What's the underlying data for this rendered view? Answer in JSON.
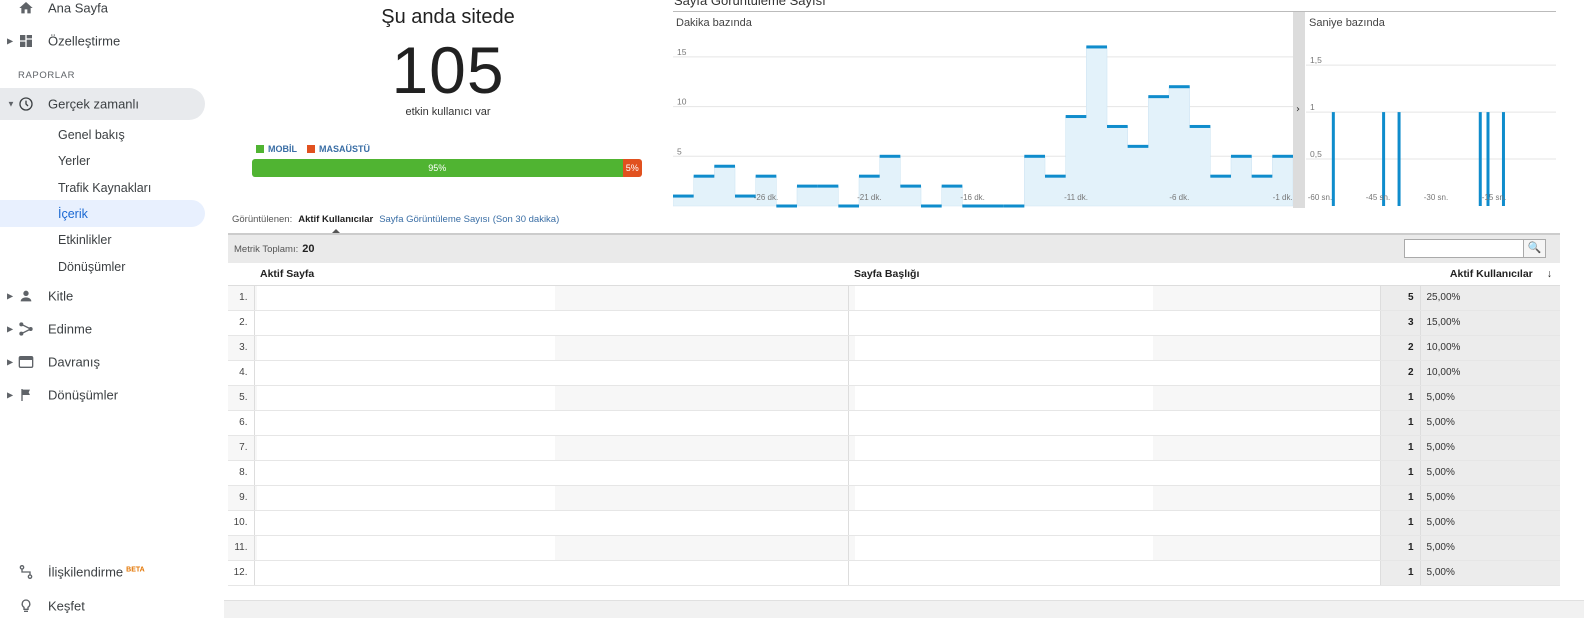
{
  "sidebar": {
    "home": "Ana Sayfa",
    "customize": "Özelleştirme",
    "section": "RAPORLAR",
    "realtime": "Gerçek zamanlı",
    "sub": [
      "Genel bakış",
      "Yerler",
      "Trafik Kaynakları",
      "İçerik",
      "Etkinlikler",
      "Dönüşümler"
    ],
    "audience": "Kitle",
    "acquisition": "Edinme",
    "behavior": "Davranış",
    "conversions": "Dönüşümler",
    "attribution": "İlişkilendirme",
    "attribution_badge": "BETA",
    "discover": "Keşfet"
  },
  "summary": {
    "title": "Şu anda sitede",
    "count": "105",
    "caption": "etkin kullanıcı var",
    "mobile_label": "MOBİL",
    "desktop_label": "MASAÜSTÜ",
    "mobile_pct": "95%",
    "desktop_pct": "5%",
    "mobile_fraction": 0.95,
    "colors": {
      "mobile": "#50b432",
      "desktop": "#e1511f"
    }
  },
  "chart_data": [
    {
      "type": "bar",
      "title": "Sayfa Görüntüleme Sayısı",
      "subtitle": "Dakika bazında",
      "x_tick_labels": [
        "-26 dk.",
        "-21 dk.",
        "-16 dk.",
        "-11 dk.",
        "-6 dk.",
        "-1 dk."
      ],
      "y_tick_labels": [
        "5",
        "10",
        "15"
      ],
      "ylim": [
        0,
        17
      ],
      "values": [
        1,
        3,
        4,
        1,
        3,
        0,
        2,
        2,
        0,
        3,
        5,
        2,
        0,
        2,
        0,
        0,
        0,
        5,
        3,
        9,
        16,
        8,
        6,
        11,
        12,
        8,
        3,
        5,
        3,
        5
      ],
      "color": "#0f8ccc"
    },
    {
      "type": "bar",
      "subtitle": "Saniye bazında",
      "x_tick_labels": [
        "-60 sn.",
        "-45 sn.",
        "-30 sn.",
        "-15 sn."
      ],
      "y_tick_labels": [
        "0,5",
        "1",
        "1,5"
      ],
      "ylim": [
        0,
        1.8
      ],
      "x": [
        -55,
        -42,
        -38,
        -17,
        -15,
        -11
      ],
      "values": [
        1,
        1,
        1,
        1,
        1,
        1
      ],
      "color": "#0f8ccc"
    }
  ],
  "view": {
    "label": "Görüntülenen:",
    "active": "Aktif Kullanıcılar",
    "link": "Sayfa Görüntüleme Sayısı (Son 30 dakika)"
  },
  "table": {
    "metric_label": "Metrik Toplamı:",
    "metric_value": "20",
    "headers": [
      "Aktif Sayfa",
      "Sayfa Başlığı",
      "Aktif Kullanıcılar"
    ],
    "rows": [
      {
        "n": "1.",
        "c": "5",
        "p": "25,00%"
      },
      {
        "n": "2.",
        "c": "3",
        "p": "15,00%"
      },
      {
        "n": "3.",
        "c": "2",
        "p": "10,00%"
      },
      {
        "n": "4.",
        "c": "2",
        "p": "10,00%"
      },
      {
        "n": "5.",
        "c": "1",
        "p": "5,00%"
      },
      {
        "n": "6.",
        "c": "1",
        "p": "5,00%"
      },
      {
        "n": "7.",
        "c": "1",
        "p": "5,00%"
      },
      {
        "n": "8.",
        "c": "1",
        "p": "5,00%"
      },
      {
        "n": "9.",
        "c": "1",
        "p": "5,00%"
      },
      {
        "n": "10.",
        "c": "1",
        "p": "5,00%"
      },
      {
        "n": "11.",
        "c": "1",
        "p": "5,00%"
      },
      {
        "n": "12.",
        "c": "1",
        "p": "5,00%"
      }
    ]
  }
}
